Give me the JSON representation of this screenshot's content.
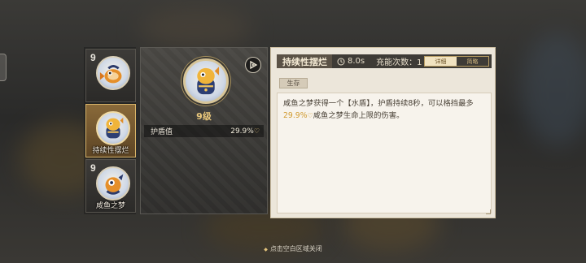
{
  "skills": [
    {
      "level": "9",
      "label": ""
    },
    {
      "level": "",
      "label": "持续性摆烂"
    },
    {
      "level": "9",
      "label": "咸鱼之梦"
    }
  ],
  "detail": {
    "level_text": "9级",
    "stat_label": "护盾值",
    "stat_value": "29.9%"
  },
  "panel": {
    "title": "持续性摆烂",
    "duration": "8.0s",
    "charge_label": "充能次数：1",
    "tab_detail": "详细",
    "tab_brief": "简略",
    "category": "生存",
    "desc_part1": "咸鱼之梦获得一个【水盾】，护盾持续8秒，可以格挡最多",
    "desc_highlight": "29.9%",
    "desc_part2": "咸鱼之梦生命上限的伤害。"
  },
  "hint": "点击空白区域关闭",
  "icons": {
    "play": "play-icon",
    "clock": "clock-icon",
    "heart": "heart-icon",
    "fish": "fish-mascot-icon"
  },
  "colors": {
    "highlight": "#d19a2e",
    "level_gold": "#e9c77b",
    "panel_dark": "#3e3b36",
    "panel_light": "#ece6da"
  }
}
